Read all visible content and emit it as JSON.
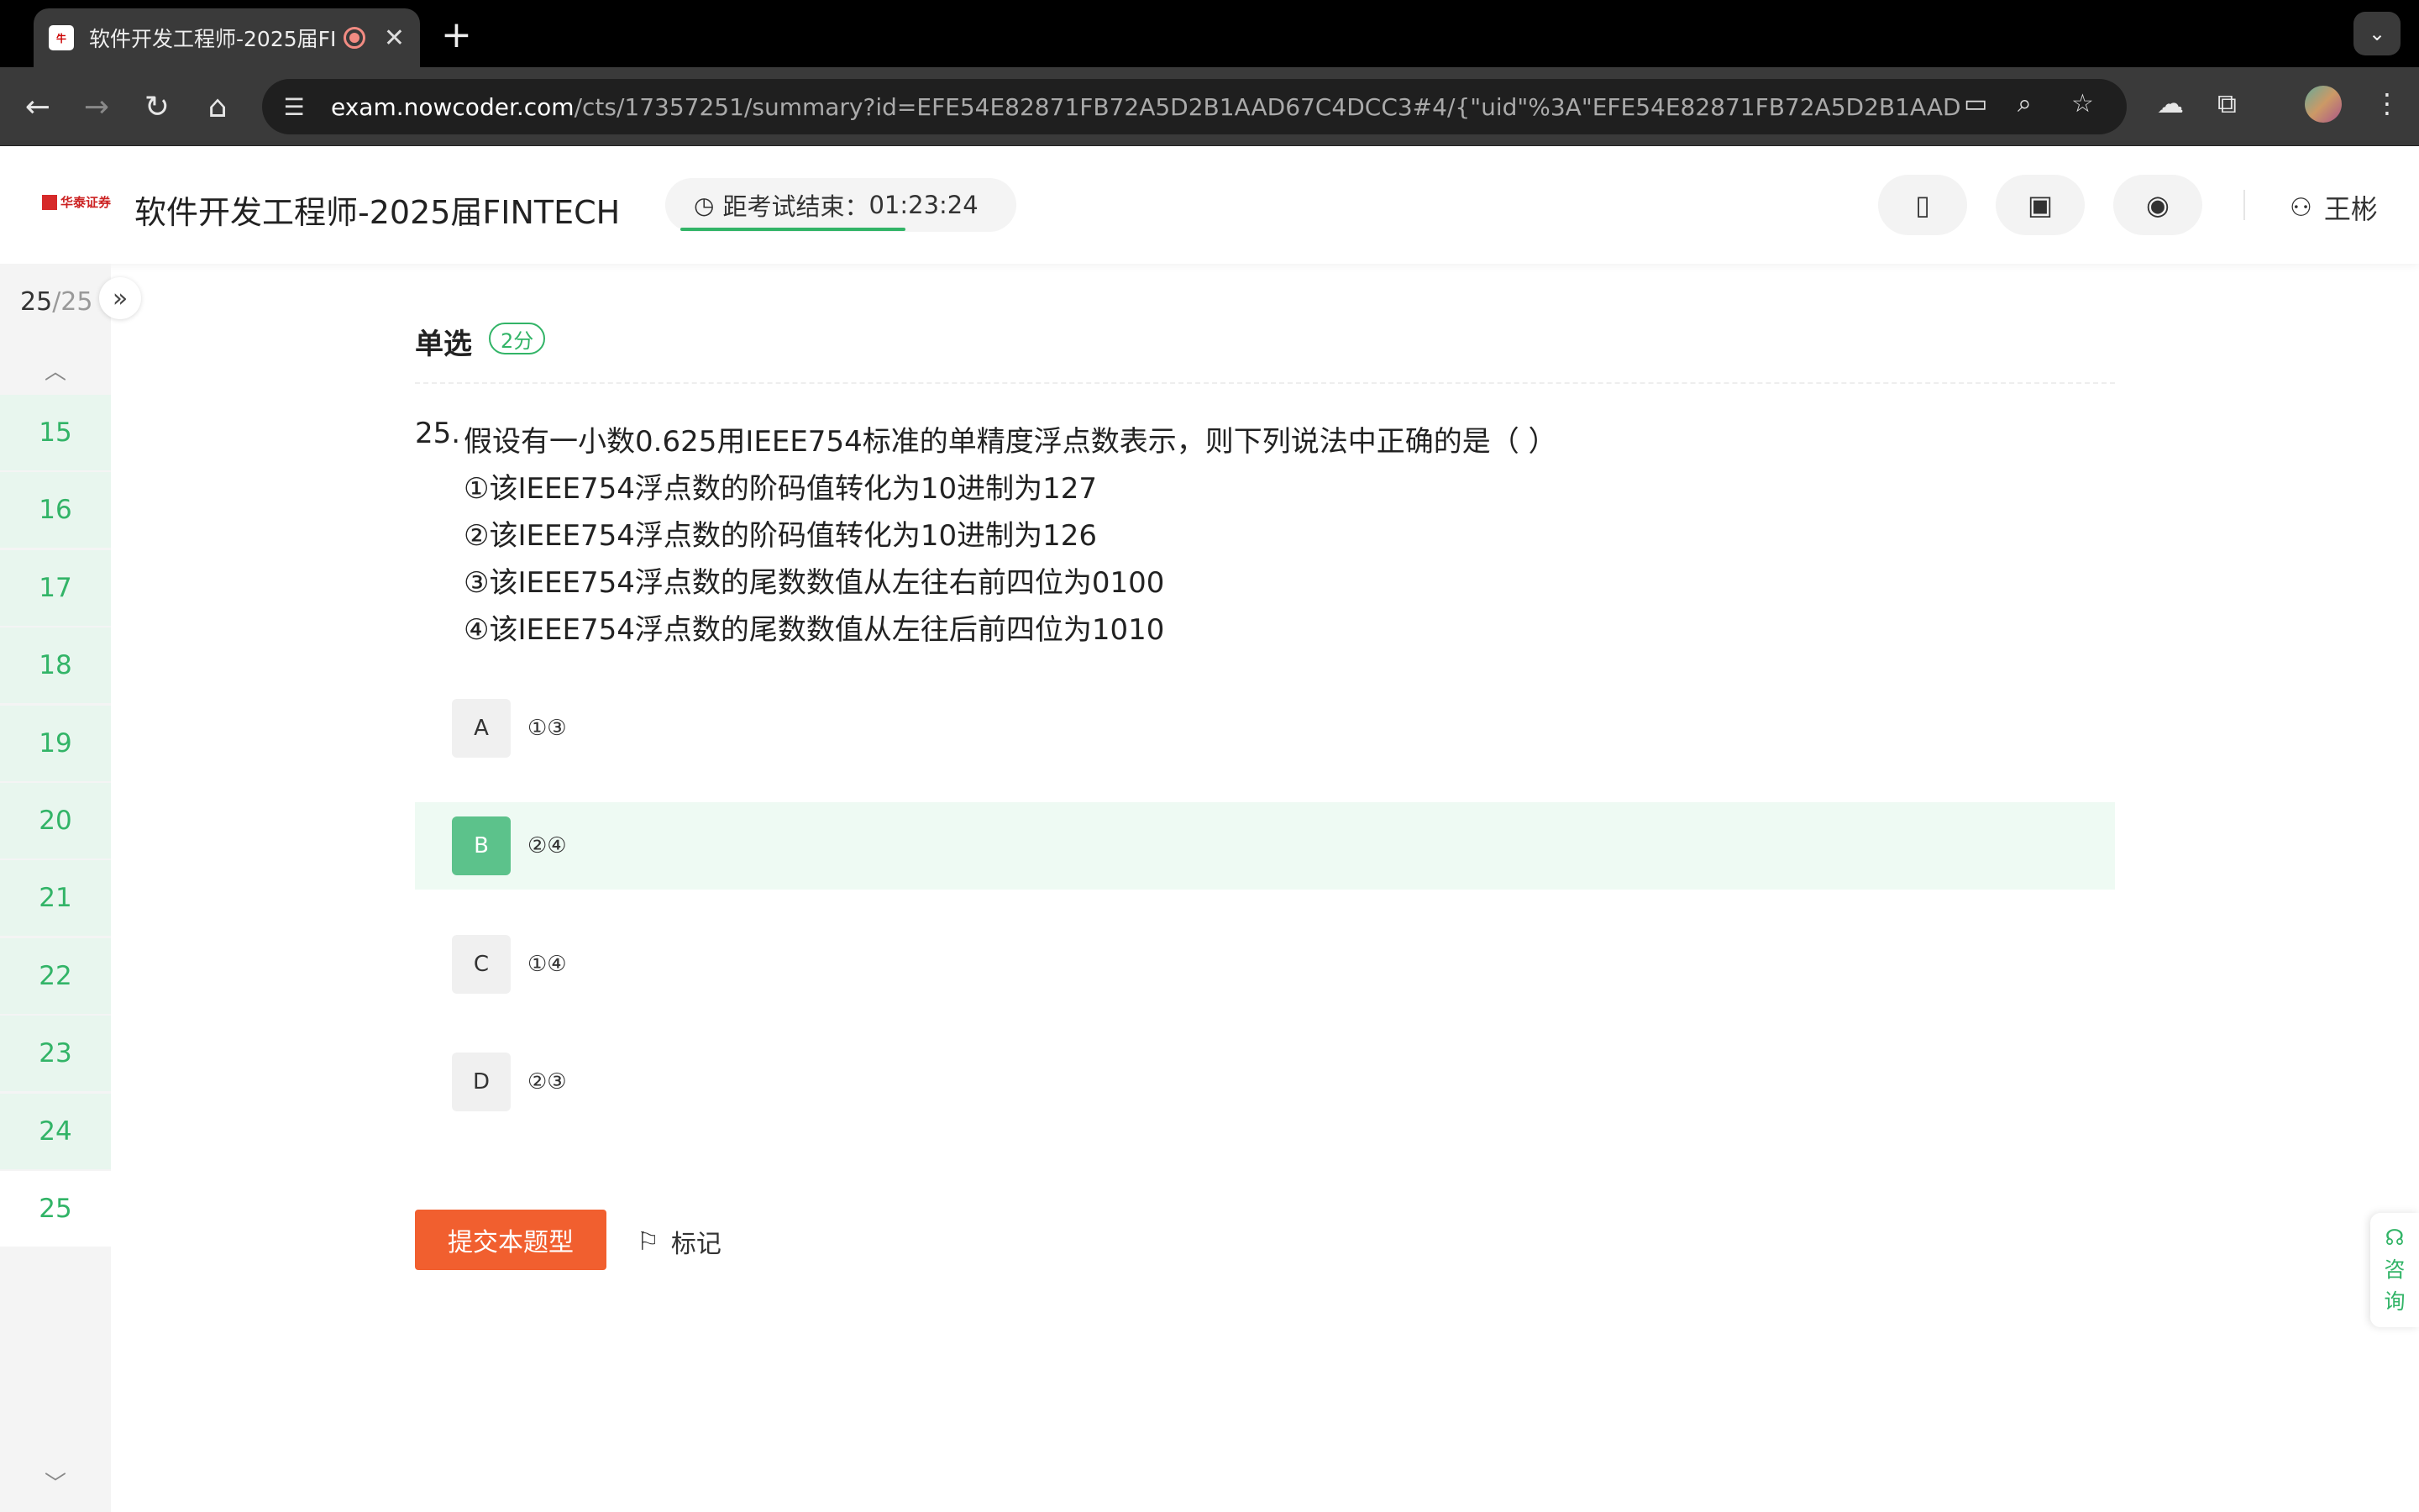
{
  "browser": {
    "tab_title": "软件开发工程师-2025届FINTECH",
    "tab_favicon_text": "牛",
    "url_host": "exam.nowcoder.com",
    "url_path": "/cts/17357251/summary?id=EFE54E82871FB72A5D2B1AAD67C4DCC3#4/{\"uid\"%3A\"EFE54E82871FB72A5D2B1AAD67C4D..."
  },
  "header": {
    "logo_text": "华泰证券",
    "exam_title": "软件开发工程师-2025届FINTECH",
    "timer_label": "距考试结束：",
    "timer_value": "01:23:24",
    "user_name": "王彬"
  },
  "sidebar": {
    "progress_current": "25",
    "progress_total": "/25",
    "questions": [
      "15",
      "16",
      "17",
      "18",
      "19",
      "20",
      "21",
      "22",
      "23",
      "24",
      "25"
    ],
    "current": "25"
  },
  "question": {
    "type": "单选",
    "score": "2分",
    "number": "25.",
    "lines": [
      "假设有一小数0.625用IEEE754标准的单精度浮点数表示，则下列说法中正确的是（ ）",
      "①该IEEE754浮点数的阶码值转化为10进制为127",
      "②该IEEE754浮点数的阶码值转化为10进制为126",
      "③该IEEE754浮点数的尾数数值从左往右前四位为0100",
      "④该IEEE754浮点数的尾数数值从左往后前四位为1010"
    ],
    "options": [
      {
        "letter": "A",
        "text": "①③"
      },
      {
        "letter": "B",
        "text": "②④"
      },
      {
        "letter": "C",
        "text": "①④"
      },
      {
        "letter": "D",
        "text": "②③"
      }
    ],
    "selected": "B"
  },
  "actions": {
    "submit_label": "提交本题型",
    "mark_label": "标记"
  },
  "consult": {
    "label_1": "咨",
    "label_2": "询"
  },
  "colors": {
    "accent_green": "#32b467",
    "submit_orange": "#f15f2f",
    "selected_bg": "#eefaf3"
  }
}
